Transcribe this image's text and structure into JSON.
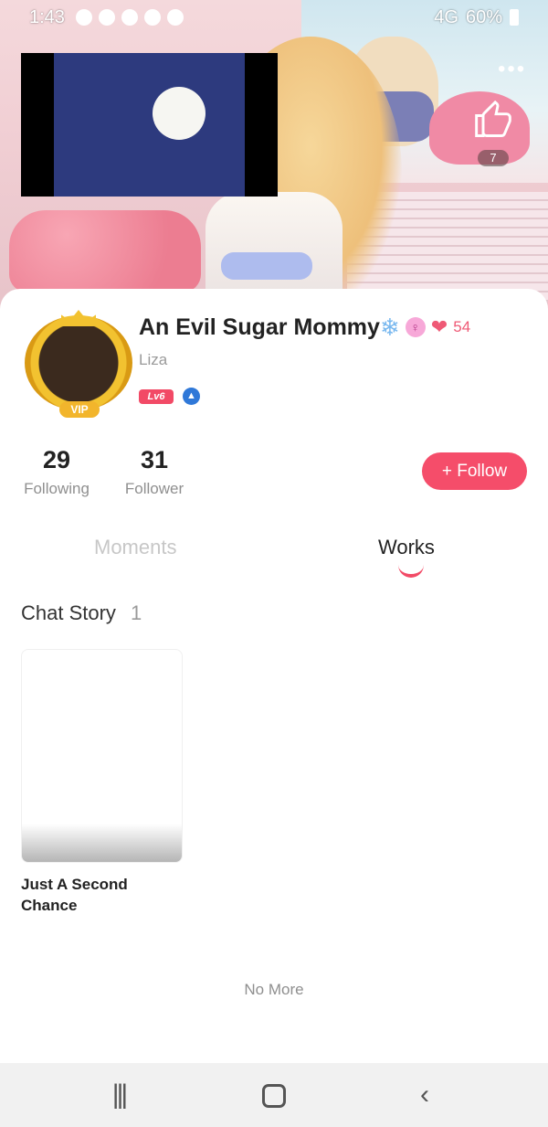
{
  "status_bar": {
    "time": "1:43",
    "network": "4G",
    "battery": "60%"
  },
  "header": {
    "more_icon": "more-dots-icon",
    "like_icon": "thumbs-up-icon",
    "like_count": "7"
  },
  "profile": {
    "name": "An Evil Sugar Mommy",
    "username": "Liza",
    "level": "Lv6",
    "avatar_badge": "VIP",
    "heart_count": "54",
    "badges": [
      "snowflake-icon",
      "gender-female-icon",
      "hearts-icon"
    ]
  },
  "stats": {
    "following_count": "29",
    "following_label": "Following",
    "follower_count": "31",
    "follower_label": "Follower"
  },
  "follow_button": {
    "label": "+ Follow"
  },
  "tabs": [
    {
      "label": "Moments",
      "active": false
    },
    {
      "label": "Works",
      "active": true
    }
  ],
  "section": {
    "title": "Chat Story",
    "count": "1"
  },
  "stories": [
    {
      "title": "Just A Second Chance"
    }
  ],
  "footer": {
    "no_more": "No More"
  },
  "colors": {
    "accent": "#f54d6a",
    "muted_text": "#8f8f8f"
  }
}
